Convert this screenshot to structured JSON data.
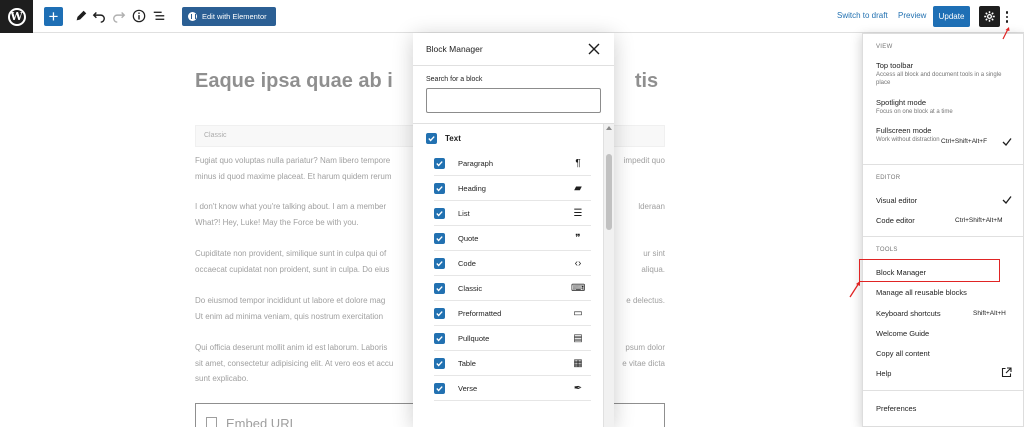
{
  "toolbar": {
    "elementor_label": "Edit with Elementor",
    "switch_draft_label": "Switch to draft",
    "preview_label": "Preview",
    "update_label": "Update"
  },
  "editor": {
    "title": "Eaque ipsa quae ab i",
    "title_tail": "tis",
    "classic_label": "Classic",
    "paragraphs": [
      {
        "left": "Fugiat quo voluptas nulla pariatur? Nam libero tempore",
        "right": "impedit quo",
        "left2": "minus id quod maxime placeat. Et harum quidem rerum",
        "right2": ""
      },
      {
        "left": "I don't know what you're talking about. I am a member",
        "right": "lderaan",
        "left2": "What?! Hey, Luke! May the Force be with you.",
        "right2": ""
      },
      {
        "left": "Cupiditate non provident, similique sunt in culpa qui of",
        "right": "ur sint",
        "left2": "occaecat cupidatat non proident, sunt in culpa. Do eius",
        "right2": "aliqua."
      },
      {
        "left": "Do eiusmod tempor incididunt ut labore et dolore mag",
        "right": "e delectus.",
        "left2": "Ut enim ad minima veniam, quis nostrum exercitation",
        "right2": ""
      },
      {
        "left": "Qui officia deserunt mollit anim id est laborum. Laboris",
        "right": "psum dolor",
        "left2": "sit amet, consectetur adipisicing elit. At vero eos et accu",
        "right2": "e vitae dicta",
        "left3": "sunt explicabo."
      }
    ],
    "embed_label": "Embed URL"
  },
  "block_manager": {
    "title": "Block Manager",
    "search_label": "Search for a block",
    "search_value": "",
    "category": "Text",
    "blocks": [
      {
        "label": "Paragraph",
        "icon": "paragraph-icon",
        "glyph": "¶"
      },
      {
        "label": "Heading",
        "icon": "bookmark-icon",
        "glyph": "▰"
      },
      {
        "label": "List",
        "icon": "list-icon",
        "glyph": "☰"
      },
      {
        "label": "Quote",
        "icon": "quote-icon",
        "glyph": "❞"
      },
      {
        "label": "Code",
        "icon": "code-icon",
        "glyph": "‹›"
      },
      {
        "label": "Classic",
        "icon": "keyboard-icon",
        "glyph": "⌨"
      },
      {
        "label": "Preformatted",
        "icon": "preformatted-icon",
        "glyph": "▭"
      },
      {
        "label": "Pullquote",
        "icon": "pullquote-icon",
        "glyph": "▤"
      },
      {
        "label": "Table",
        "icon": "table-icon",
        "glyph": "▦"
      },
      {
        "label": "Verse",
        "icon": "feather-icon",
        "glyph": "✒"
      }
    ]
  },
  "options_menu": {
    "view_label": "VIEW",
    "top_toolbar": {
      "title": "Top toolbar",
      "desc": "Access all block and document tools in a single place"
    },
    "spotlight": {
      "title": "Spotlight mode",
      "desc": "Focus on one block at a time"
    },
    "fullscreen": {
      "title": "Fullscreen mode",
      "desc": "Work without distraction",
      "shortcut": "Ctrl+Shift+Alt+F"
    },
    "editor_label": "EDITOR",
    "visual_editor": "Visual editor",
    "code_editor": {
      "title": "Code editor",
      "shortcut": "Ctrl+Shift+Alt+M"
    },
    "tools_label": "TOOLS",
    "block_manager": "Block Manager",
    "manage_reusable": "Manage all reusable blocks",
    "keyboard_shortcuts": {
      "title": "Keyboard shortcuts",
      "shortcut": "Shift+Alt+H"
    },
    "welcome_guide": "Welcome Guide",
    "copy_content": "Copy all content",
    "help": "Help",
    "preferences": "Preferences"
  },
  "colors": {
    "accent": "#2271b1",
    "dark": "#1e1e1e",
    "highlight": "#e02424"
  }
}
